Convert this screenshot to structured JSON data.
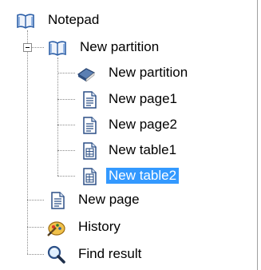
{
  "tree": {
    "root": {
      "label": "Notepad",
      "icon": "open-book-icon"
    },
    "partition": {
      "label": "New partition",
      "icon": "open-book-icon",
      "expanded": true
    },
    "children": [
      {
        "label": "New partition",
        "icon": "closed-book-icon"
      },
      {
        "label": "New page1",
        "icon": "page-icon"
      },
      {
        "label": "New page2",
        "icon": "page-icon"
      },
      {
        "label": "New table1",
        "icon": "table-icon"
      },
      {
        "label": "New table2",
        "icon": "table-icon",
        "selected": true
      }
    ],
    "items": [
      {
        "label": "New page",
        "icon": "page-icon"
      },
      {
        "label": "History",
        "icon": "history-icon"
      },
      {
        "label": "Find result",
        "icon": "magnifier-icon"
      }
    ]
  },
  "colors": {
    "selection": "#3399ff",
    "tree_line": "#8a8a8a"
  }
}
